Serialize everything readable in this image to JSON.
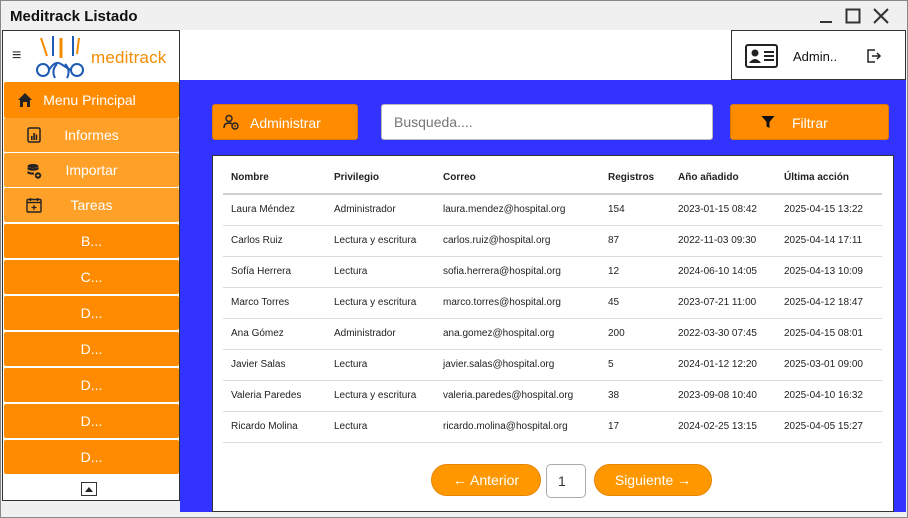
{
  "window": {
    "title": "Meditrack Listado"
  },
  "logo": {
    "text": "meditrack"
  },
  "user": {
    "name": "Admin.."
  },
  "sidebar": {
    "items": [
      {
        "label": "Menu Principal",
        "icon": "home-icon",
        "kind": "main"
      },
      {
        "label": "Informes",
        "icon": "report-icon",
        "kind": "sub"
      },
      {
        "label": "Importar",
        "icon": "database-import-icon",
        "kind": "sub"
      },
      {
        "label": "Tareas",
        "icon": "calendar-add-icon",
        "kind": "sub"
      },
      {
        "label": "B...",
        "kind": "main"
      },
      {
        "label": "C...",
        "kind": "main"
      },
      {
        "label": "D...",
        "kind": "main"
      },
      {
        "label": "D...",
        "kind": "main"
      },
      {
        "label": "D...",
        "kind": "main"
      },
      {
        "label": "D...",
        "kind": "main"
      },
      {
        "label": "D...",
        "kind": "main"
      }
    ]
  },
  "toolbar": {
    "admin_label": "Administrar",
    "search_placeholder": "Busqueda....",
    "filter_label": "Filtrar"
  },
  "table": {
    "headers": [
      "Nombre",
      "Privilegio",
      "Correo",
      "Registros",
      "Año añadido",
      "Última acción"
    ],
    "rows": [
      [
        "Laura Méndez",
        "Administrador",
        "laura.mendez@hospital.org",
        "154",
        "2023-01-15 08:42",
        "2025-04-15 13:22"
      ],
      [
        "Carlos Ruiz",
        "Lectura y escritura",
        "carlos.ruiz@hospital.org",
        "87",
        "2022-11-03 09:30",
        "2025-04-14 17:11"
      ],
      [
        "Sofía Herrera",
        "Lectura",
        "sofia.herrera@hospital.org",
        "12",
        "2024-06-10 14:05",
        "2025-04-13 10:09"
      ],
      [
        "Marco Torres",
        "Lectura y escritura",
        "marco.torres@hospital.org",
        "45",
        "2023-07-21 11:00",
        "2025-04-12 18:47"
      ],
      [
        "Ana Gómez",
        "Administrador",
        "ana.gomez@hospital.org",
        "200",
        "2022-03-30 07:45",
        "2025-04-15 08:01"
      ],
      [
        "Javier Salas",
        "Lectura",
        "javier.salas@hospital.org",
        "5",
        "2024-01-12 12:20",
        "2025-03-01 09:00"
      ],
      [
        "Valeria Paredes",
        "Lectura y escritura",
        "valeria.paredes@hospital.org",
        "38",
        "2023-09-08 10:40",
        "2025-04-10 16:32"
      ],
      [
        "Ricardo Molina",
        "Lectura",
        "ricardo.molina@hospital.org",
        "17",
        "2024-02-25 13:15",
        "2025-04-05 15:27"
      ]
    ]
  },
  "pagination": {
    "prev_label": "← Anterior",
    "page": "1",
    "next_label": "Siguiente →"
  },
  "colors": {
    "accent": "#ff8c00",
    "background": "#3333ff"
  }
}
